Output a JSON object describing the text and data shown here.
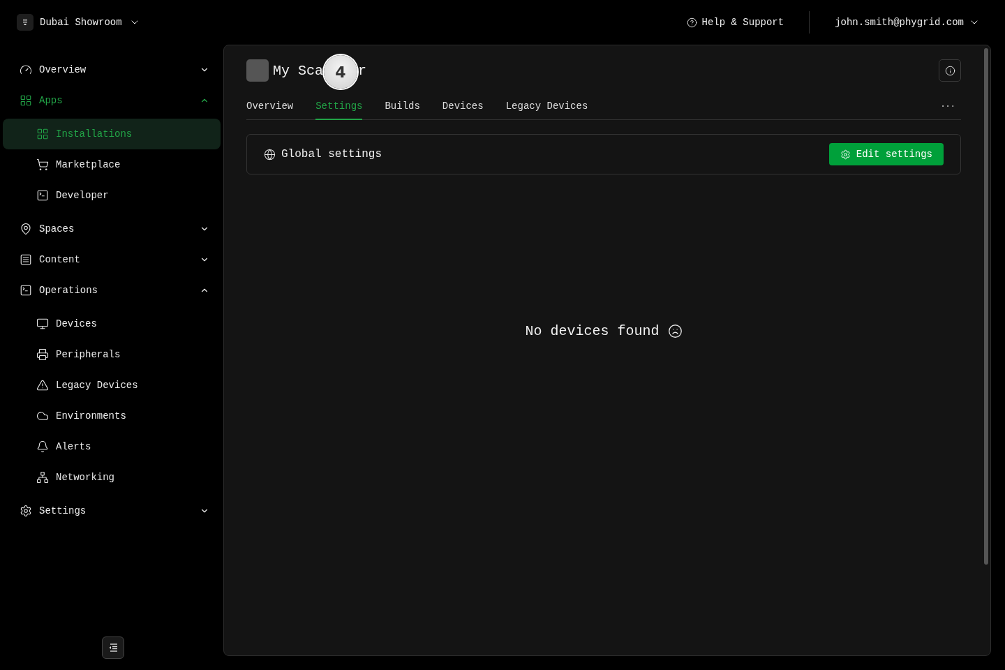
{
  "workspace": {
    "name": "Dubai Showroom"
  },
  "header": {
    "help": "Help & Support",
    "user": "john.smith@phygrid.com"
  },
  "sidebar": {
    "items": [
      {
        "label": "Overview",
        "expanded": false,
        "selected": false
      },
      {
        "label": "Apps",
        "expanded": true,
        "selected": true,
        "children": [
          {
            "label": "Installations",
            "selected": true
          },
          {
            "label": "Marketplace",
            "selected": false
          },
          {
            "label": "Developer",
            "selected": false
          }
        ]
      },
      {
        "label": "Spaces",
        "expanded": false,
        "selected": false
      },
      {
        "label": "Content",
        "expanded": false,
        "selected": false
      },
      {
        "label": "Operations",
        "expanded": true,
        "selected": false,
        "children": [
          {
            "label": "Devices",
            "selected": false
          },
          {
            "label": "Peripherals",
            "selected": false
          },
          {
            "label": "Legacy Devices",
            "selected": false
          },
          {
            "label": "Environments",
            "selected": false
          },
          {
            "label": "Alerts",
            "selected": false
          },
          {
            "label": "Networking",
            "selected": false
          }
        ]
      },
      {
        "label": "Settings",
        "expanded": false,
        "selected": false
      }
    ]
  },
  "app": {
    "title_start": "My Sca",
    "title_end": "r",
    "step_marker": "4"
  },
  "tabs": [
    {
      "label": "Overview",
      "selected": false
    },
    {
      "label": "Settings",
      "selected": true
    },
    {
      "label": "Builds",
      "selected": false
    },
    {
      "label": "Devices",
      "selected": false
    },
    {
      "label": "Legacy Devices",
      "selected": false
    }
  ],
  "more": "...",
  "settings_card": {
    "title": "Global settings",
    "button": "Edit settings"
  },
  "empty_state": "No devices found"
}
